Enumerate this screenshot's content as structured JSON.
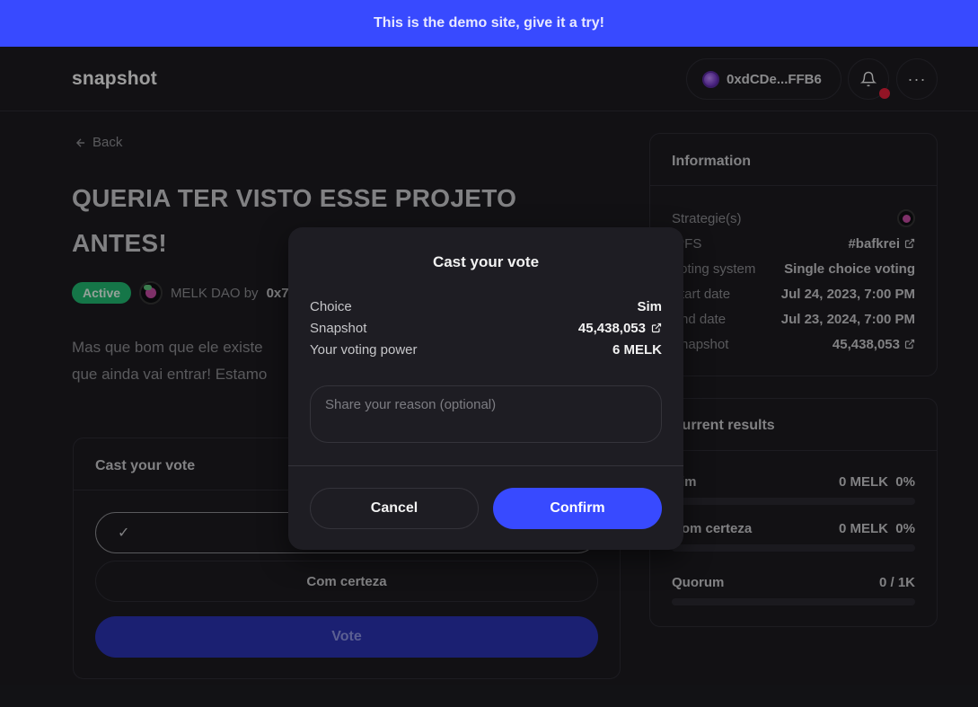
{
  "banner": {
    "text": "This is the demo site, give it a try!"
  },
  "header": {
    "logo": "snapshot",
    "wallet_address": "0xdCDe...FFB6",
    "more_label": "···"
  },
  "proposal": {
    "back_label": "Back",
    "title": "QUERIA TER VISTO ESSE PROJETO ANTES!",
    "status": "Active",
    "space": "MELK DAO by",
    "author": "0x7",
    "body_line1": "Mas que bom que ele existe",
    "body_line2": "que ainda vai entrar! Estamo"
  },
  "vote_panel": {
    "title": "Cast your vote",
    "check": "✓",
    "choice_2": "Com certeza",
    "vote_label": "Vote"
  },
  "information": {
    "title": "Information",
    "rows": [
      {
        "label": "Strategie(s)",
        "value": ""
      },
      {
        "label": "IPFS",
        "value": "#bafkrei"
      },
      {
        "label": "Voting system",
        "value": "Single choice voting"
      },
      {
        "label": "Start date",
        "value": "Jul 24, 2023, 7:00 PM"
      },
      {
        "label": "End date",
        "value": "Jul 23, 2024, 7:00 PM"
      },
      {
        "label": "Snapshot",
        "value": "45,438,053"
      }
    ]
  },
  "results": {
    "title": "Current results",
    "items": [
      {
        "label": "Sim",
        "value": "0 MELK  0%",
        "progress": 0
      },
      {
        "label": "Com certeza",
        "value": "0 MELK  0%",
        "progress": 0
      }
    ],
    "quorum_label": "Quorum",
    "quorum_value": "0 / 1K",
    "quorum_progress": 0
  },
  "modal": {
    "title": "Cast your vote",
    "rows": [
      {
        "label": "Choice",
        "value": "Sim"
      },
      {
        "label": "Snapshot",
        "value": "45,438,053"
      },
      {
        "label": "Your voting power",
        "value": "6 MELK"
      }
    ],
    "reason_placeholder": "Share your reason (optional)",
    "cancel_label": "Cancel",
    "confirm_label": "Confirm"
  },
  "colors": {
    "accent": "#384aff",
    "active_badge": "#21b66f",
    "notification_dot": "#e0203a",
    "background": "#1c1b20"
  }
}
